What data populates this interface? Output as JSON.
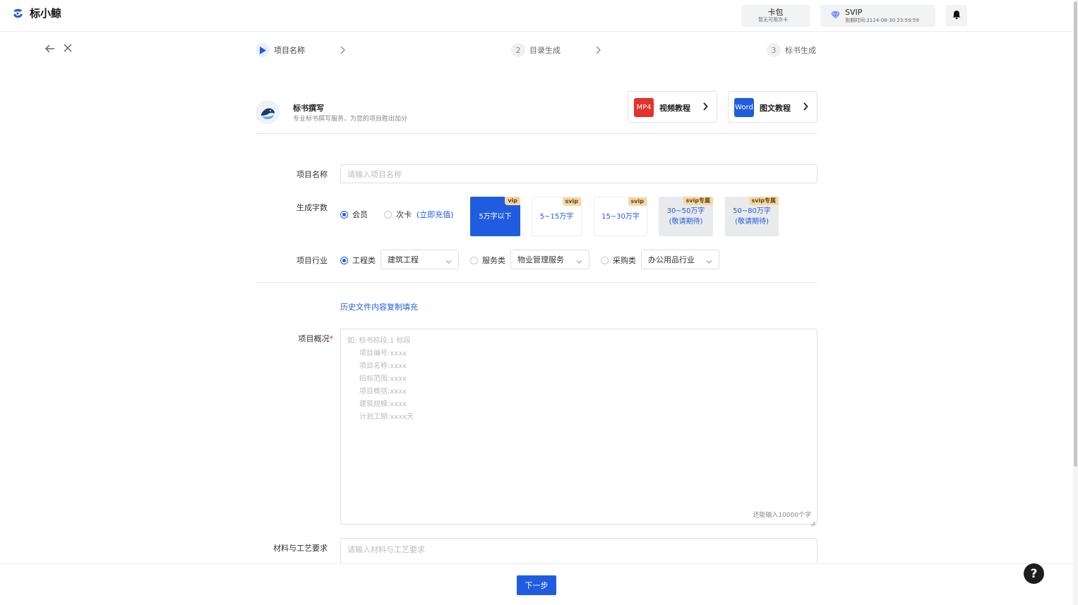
{
  "app": {
    "name": "标小鲸"
  },
  "top": {
    "wallet": {
      "title": "卡包",
      "subtitle": "暂无可用次卡"
    },
    "svip": {
      "title": "SVIP",
      "expiry": "到期时间:2124-08-30 23:59:59"
    }
  },
  "steps": [
    {
      "num": "",
      "label": "项目名称",
      "active": true
    },
    {
      "num": "2",
      "label": "目录生成"
    },
    {
      "num": "3",
      "label": "标书生成"
    }
  ],
  "intro": {
    "title": "标书撰写",
    "subtitle": "专业标书撰写服务，为您的项目胜出加分",
    "tutorials": [
      {
        "badge": "MP4",
        "label": "视频教程",
        "color": "#e5322d"
      },
      {
        "badge": "Word",
        "label": "图文教程",
        "color": "#1f5ce0"
      }
    ]
  },
  "form": {
    "project_name": {
      "label": "项目名称",
      "placeholder": "请输入项目名称"
    },
    "word_count": {
      "label": "生成字数",
      "radios": [
        {
          "label": "会员",
          "checked": true
        },
        {
          "label": "次卡",
          "checked": false
        }
      ],
      "recharge_link": "(立即充值)",
      "options": [
        {
          "tag": "vip",
          "line1": "5万字以下",
          "line2": "",
          "state": "selected"
        },
        {
          "tag": "svip",
          "line1": "5~15万字",
          "line2": "",
          "state": "plain"
        },
        {
          "tag": "svip",
          "line1": "15~30万字",
          "line2": "",
          "state": "plain"
        },
        {
          "tag": "svip专属",
          "line1": "30~50万字",
          "line2": "(敬请期待)",
          "state": "disabled"
        },
        {
          "tag": "svip专属",
          "line1": "50~80万字",
          "line2": "(敬请期待)",
          "state": "disabled"
        }
      ]
    },
    "industry": {
      "label": "项目行业",
      "groups": [
        {
          "radio": "工程类",
          "checked": true,
          "value": "建筑工程"
        },
        {
          "radio": "服务类",
          "checked": false,
          "value": "物业管理服务"
        },
        {
          "radio": "采购类",
          "checked": false,
          "value": "办公用品行业"
        }
      ]
    },
    "history_link": "历史文件内容复制填充",
    "overview": {
      "label": "项目概况",
      "required_mark": "*",
      "placeholder_lines": [
        "如: 标书标段:1 标段",
        "项目编号:xxxx",
        "项目名称:xxxx",
        "招标范围:xxxx",
        "项目概括:xxxx",
        "建筑规模:xxxx",
        "计划工期:xxxx天"
      ],
      "counter": "还能输入10000个字"
    },
    "materials": {
      "label": "材料与工艺要求",
      "placeholder": "请输入材料与工艺要求"
    }
  },
  "footer": {
    "next_label": "下一步",
    "help_label": "?"
  },
  "colors": {
    "primary": "#1f5ce0",
    "tag_bg": "#f3d8a6",
    "mp4_red": "#e5322d"
  }
}
